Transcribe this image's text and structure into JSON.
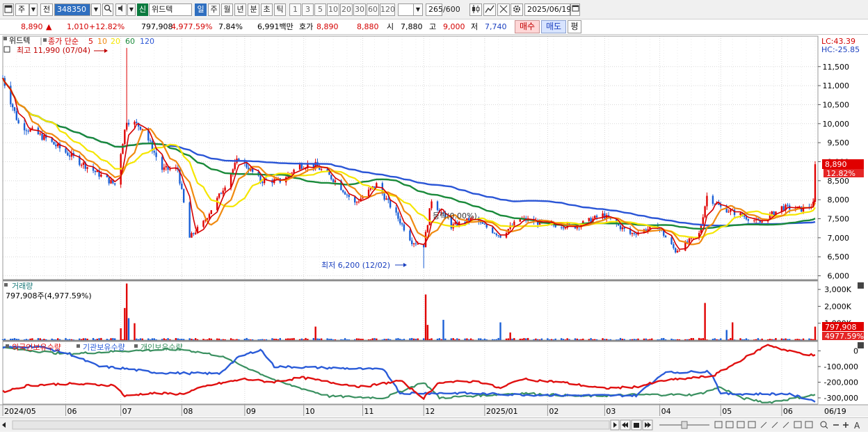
{
  "toolbar": {
    "market": "주",
    "prev_label": "전",
    "stock_code": "348350",
    "shin_label": "신",
    "stock_name": "위드텍",
    "periods": [
      "일",
      "주",
      "월",
      "년",
      "분",
      "초",
      "틱"
    ],
    "period_selected": "일",
    "intervals": [
      "1",
      "3",
      "5",
      "10",
      "20",
      "30",
      "60",
      "120"
    ],
    "count": "265",
    "count_max": "/600",
    "date": "2025/06/19"
  },
  "quote": {
    "price": "8,890",
    "arrow": "▲",
    "change": "1,010",
    "change_pct": "+12.82%",
    "volume": "797,908",
    "volume_pct": "4,977.59%",
    "turnover": "7.84%",
    "amount": "6,991백만",
    "hoga_label": "호가",
    "ask": "8,890",
    "bid": "8,880",
    "open_label": "시",
    "open": "7,880",
    "high_label": "고",
    "high": "9,000",
    "low_label": "저",
    "low": "7,740",
    "buy_button": "매수",
    "sell_button": "매도",
    "eval_button": "평"
  },
  "colors": {
    "candle_up": "#e00000",
    "candle_down": "#1a5fd6",
    "ma5": "#d40000",
    "ma10": "#f08a10",
    "ma20": "#f5e600",
    "ma60": "#1a8a3a",
    "ma120": "#2a55d6",
    "foreign": "#e01010",
    "institution": "#2a5bd8",
    "individual": "#3a9060"
  },
  "chart_data": [
    {
      "type": "line",
      "subtype": "candlestick",
      "panel": "price",
      "legend_name": "위드텍",
      "legend_ma_label": "종가 단순",
      "ma_periods": [
        "5",
        "10",
        "20",
        "60",
        "120"
      ],
      "lc_label": "LC:43.39",
      "hc_label": "HC:-25.85",
      "ylim": [
        5900,
        12300
      ],
      "y_ticks": [
        "11,500",
        "11,000",
        "10,500",
        "10,000",
        "9,500",
        "9,000",
        "8,500",
        "8,000",
        "7,500",
        "7,000",
        "6,500",
        "6,000"
      ],
      "current_price_label": "8,890",
      "current_pct_label": "12.82%",
      "annotation_high": "최고 11,990 (07/04)",
      "annotation_low": "최저 6,200 (12/02)",
      "annotation_mid": "등락(0.00%)",
      "key_prices": {
        "2024-05-02": 11200,
        "2024-05-10": 10000,
        "2024-05-24": 9600,
        "2024-06-10": 9000,
        "2024-06-28": 8400,
        "2024-07-04": 10100,
        "2024-07-12": 9900,
        "2024-07-22": 8800,
        "2024-07-30": 8800,
        "2024-08-05": 7000,
        "2024-08-12": 7400,
        "2024-08-20": 8100,
        "2024-08-30": 9100,
        "2024-09-10": 8500,
        "2024-09-20": 8500,
        "2024-09-30": 8900,
        "2024-10-08": 8900,
        "2024-10-18": 8500,
        "2024-10-28": 7900,
        "2024-11-08": 8400,
        "2024-11-18": 7600,
        "2024-11-26": 6900,
        "2024-12-02": 6800,
        "2024-12-06": 8000,
        "2024-12-16": 7300,
        "2024-12-27": 7500,
        "2025-01-10": 7050,
        "2025-01-20": 7500,
        "2025-02-03": 7350,
        "2025-02-17": 7300,
        "2025-03-03": 7600,
        "2025-03-17": 7100,
        "2025-03-31": 7300,
        "2025-04-09": 6650,
        "2025-04-21": 7100,
        "2025-04-25": 8100,
        "2025-05-02": 7800,
        "2025-05-12": 7600,
        "2025-05-22": 7400,
        "2025-06-02": 7800,
        "2025-06-12": 7750,
        "2025-06-18": 7880,
        "2025-06-19": 8890
      },
      "x_ticks": [
        "2024/05",
        "06",
        "07",
        "08",
        "09",
        "10",
        "11",
        "12",
        "2025/01",
        "02",
        "03",
        "04",
        "05",
        "06"
      ],
      "x_last_label": "06/19"
    },
    {
      "type": "bar",
      "panel": "volume",
      "title": "거래량",
      "current_label": "797,908주(4,977.59%)",
      "ylim": [
        0,
        3500
      ],
      "y_ticks": [
        "3,000K",
        "2,000K",
        "1,000K"
      ],
      "current_value_label": "797,908",
      "current_pct_label": "4977.59%",
      "unit": "K shares",
      "spikes": [
        {
          "date": "2024-07-01",
          "value": 700
        },
        {
          "date": "2024-07-03",
          "value": 1900
        },
        {
          "date": "2024-07-04",
          "value": 3350
        },
        {
          "date": "2024-07-05",
          "value": 1300
        },
        {
          "date": "2024-07-08",
          "value": 1000
        },
        {
          "date": "2024-10-08",
          "value": 800
        },
        {
          "date": "2024-12-03",
          "value": 2700
        },
        {
          "date": "2024-12-04",
          "value": 900
        },
        {
          "date": "2024-12-12",
          "value": 1200
        },
        {
          "date": "2025-01-10",
          "value": 1050
        },
        {
          "date": "2025-01-15",
          "value": 450
        },
        {
          "date": "2025-04-24",
          "value": 2200
        },
        {
          "date": "2025-05-05",
          "value": 600
        },
        {
          "date": "2025-05-08",
          "value": 1050
        },
        {
          "date": "2025-06-19",
          "value": 798
        }
      ],
      "base_level": 80
    },
    {
      "type": "line",
      "panel": "holdings",
      "series_names": [
        "외국인보유수량",
        "기관보유수량",
        "개인보유수량"
      ],
      "ylim": [
        -340000,
        60000
      ],
      "y_ticks": [
        "0",
        "-100,000",
        "-200,000",
        "-300,000"
      ],
      "series": [
        {
          "name": "외국인보유수량",
          "points": [
            [
              "2024-05-02",
              -260000
            ],
            [
              "2024-05-15",
              -220000
            ],
            [
              "2024-06-03",
              -210000
            ],
            [
              "2024-06-28",
              -220000
            ],
            [
              "2024-07-03",
              -290000
            ],
            [
              "2024-07-15",
              -270000
            ],
            [
              "2024-08-01",
              -275000
            ],
            [
              "2024-08-15",
              -220000
            ],
            [
              "2024-09-02",
              -180000
            ],
            [
              "2024-09-16",
              -200000
            ],
            [
              "2024-10-01",
              -170000
            ],
            [
              "2024-10-15",
              -200000
            ],
            [
              "2024-11-01",
              -230000
            ],
            [
              "2024-11-20",
              -190000
            ],
            [
              "2024-12-02",
              -300000
            ],
            [
              "2024-12-10",
              -200000
            ],
            [
              "2024-12-30",
              -195000
            ],
            [
              "2025-01-10",
              -240000
            ],
            [
              "2025-01-20",
              -180000
            ],
            [
              "2025-02-10",
              -200000
            ],
            [
              "2025-03-03",
              -240000
            ],
            [
              "2025-03-20",
              -230000
            ],
            [
              "2025-04-03",
              -190000
            ],
            [
              "2025-04-20",
              -170000
            ],
            [
              "2025-04-28",
              -160000
            ],
            [
              "2025-05-08",
              -90000
            ],
            [
              "2025-05-26",
              40000
            ],
            [
              "2025-06-05",
              0
            ],
            [
              "2025-06-19",
              -30000
            ]
          ]
        },
        {
          "name": "기관보유수량",
          "points": [
            [
              "2024-05-02",
              20000
            ],
            [
              "2024-05-20",
              30000
            ],
            [
              "2024-06-05",
              -20000
            ],
            [
              "2024-06-20",
              -100000
            ],
            [
              "2024-07-01",
              -110000
            ],
            [
              "2024-07-20",
              -140000
            ],
            [
              "2024-08-20",
              -145000
            ],
            [
              "2024-08-30",
              -40000
            ],
            [
              "2024-09-10",
              10000
            ],
            [
              "2024-09-17",
              -100000
            ],
            [
              "2024-10-20",
              -110000
            ],
            [
              "2024-11-12",
              -120000
            ],
            [
              "2024-11-20",
              -270000
            ],
            [
              "2024-12-20",
              -270000
            ],
            [
              "2025-01-20",
              -280000
            ],
            [
              "2025-02-20",
              -285000
            ],
            [
              "2025-03-20",
              -285000
            ],
            [
              "2025-04-03",
              -140000
            ],
            [
              "2025-04-27",
              -130000
            ],
            [
              "2025-05-02",
              -275000
            ],
            [
              "2025-06-05",
              -275000
            ],
            [
              "2025-06-19",
              -320000
            ]
          ]
        },
        {
          "name": "개인보유수량",
          "points": [
            [
              "2024-05-02",
              20000
            ],
            [
              "2024-06-03",
              -20000
            ],
            [
              "2024-07-03",
              0
            ],
            [
              "2024-08-01",
              10000
            ],
            [
              "2024-08-20",
              -30000
            ],
            [
              "2024-09-20",
              -200000
            ],
            [
              "2024-10-15",
              -290000
            ],
            [
              "2024-11-12",
              -300000
            ],
            [
              "2024-12-02",
              -200000
            ],
            [
              "2024-12-10",
              -300000
            ],
            [
              "2025-01-20",
              -270000
            ],
            [
              "2025-02-20",
              -290000
            ],
            [
              "2025-03-20",
              -280000
            ],
            [
              "2025-04-20",
              -280000
            ],
            [
              "2025-05-02",
              -230000
            ],
            [
              "2025-05-12",
              -300000
            ],
            [
              "2025-05-26",
              -330000
            ],
            [
              "2025-06-10",
              -300000
            ],
            [
              "2025-06-19",
              -280000
            ]
          ]
        }
      ]
    }
  ]
}
